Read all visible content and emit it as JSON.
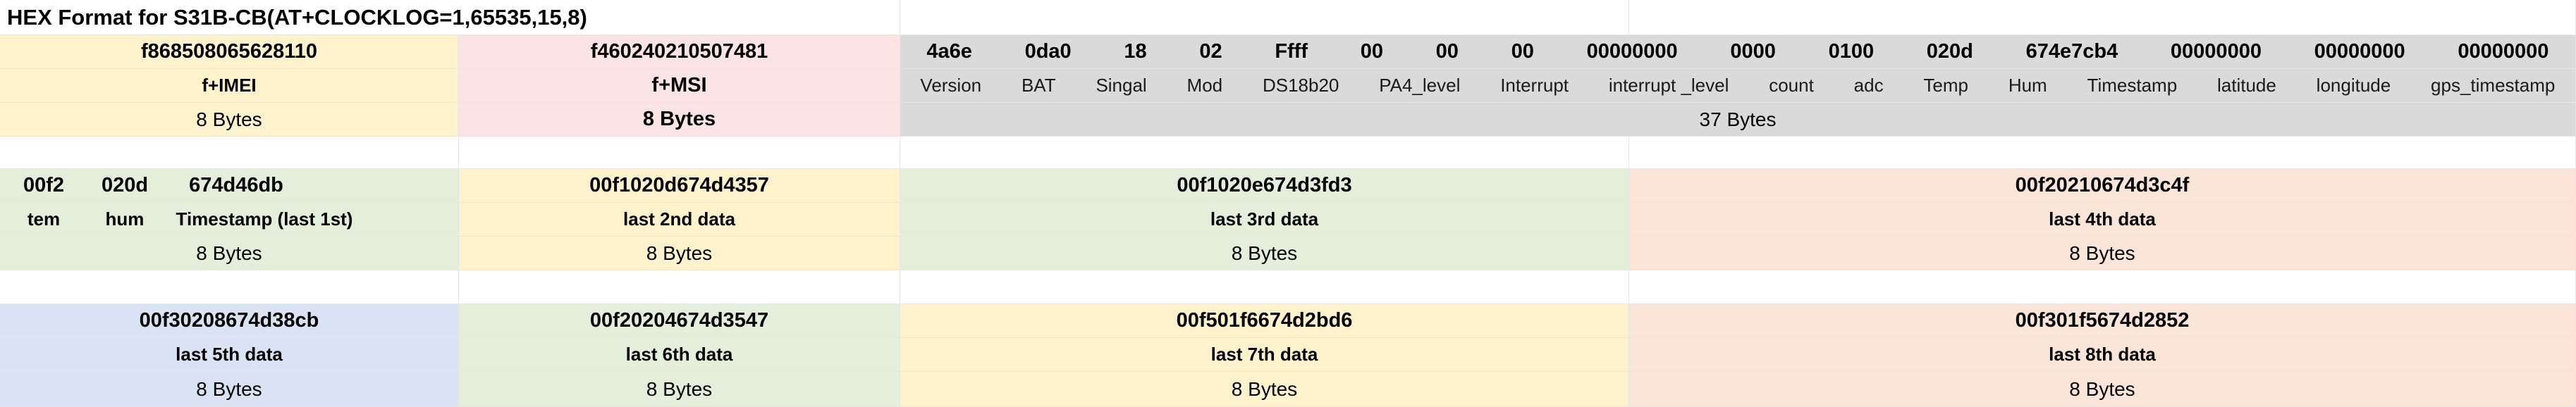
{
  "title": "HEX Format for S31B-CB(AT+CLOCKLOG=1,65535,15,8)",
  "colors": {
    "yellow": "#fef2cc",
    "pink": "#fde4e4",
    "gray": "#dadada",
    "green": "#e3efda",
    "orange": "#fbe5d8",
    "blue": "#dae3f3",
    "grid": "#e6e6e6"
  },
  "section1": {
    "imei": {
      "hex": "f868508065628110",
      "label": "f+IMEI",
      "size": "8 Bytes"
    },
    "msi": {
      "hex": "f460240210507481",
      "label": "f+MSI",
      "size": "8 Bytes"
    },
    "fields": [
      {
        "hex": "4a6e",
        "label": "Version"
      },
      {
        "hex": "0da0",
        "label": "BAT"
      },
      {
        "hex": "18",
        "label": "Singal"
      },
      {
        "hex": "02",
        "label": "Mod"
      },
      {
        "hex": "Ffff",
        "label": "DS18b20"
      },
      {
        "hex": "00",
        "label": "PA4_level"
      },
      {
        "hex": "00",
        "label": "Interrupt"
      },
      {
        "hex": "00",
        "label": "interrupt _level"
      },
      {
        "hex": "00000000",
        "label": "count"
      },
      {
        "hex": "0000",
        "label": "adc"
      },
      {
        "hex": "0100",
        "label": "Temp"
      },
      {
        "hex": "020d",
        "label": "Hum"
      },
      {
        "hex": "674e7cb4",
        "label": "Timestamp"
      },
      {
        "hex": "00000000",
        "label": "latitude"
      },
      {
        "hex": "00000000",
        "label": "longitude"
      },
      {
        "hex": "00000000",
        "label": "gps_timestamp"
      }
    ],
    "fields_size": "37 Bytes"
  },
  "section2": {
    "first": {
      "parts": [
        {
          "hex": "00f2",
          "label": "tem"
        },
        {
          "hex": "020d",
          "label": "hum"
        },
        {
          "hex": "674d46db",
          "label": "Timestamp (last 1st)"
        }
      ],
      "size": "8 Bytes"
    },
    "blocks": [
      {
        "hex": "00f1020d674d4357",
        "label": "last 2nd data",
        "size": "8 Bytes"
      },
      {
        "hex": "00f1020e674d3fd3",
        "label": "last 3rd data",
        "size": "8 Bytes"
      },
      {
        "hex": "00f20210674d3c4f",
        "label": "last 4th data",
        "size": "8 Bytes"
      }
    ]
  },
  "section3": {
    "blocks": [
      {
        "hex": "00f30208674d38cb",
        "label": "last 5th data",
        "size": "8 Bytes"
      },
      {
        "hex": "00f20204674d3547",
        "label": "last 6th data",
        "size": "8 Bytes"
      },
      {
        "hex": "00f501f6674d2bd6",
        "label": "last 7th data",
        "size": "8 Bytes"
      },
      {
        "hex": "00f301f5674d2852",
        "label": "last 8th data",
        "size": "8 Bytes"
      }
    ]
  }
}
